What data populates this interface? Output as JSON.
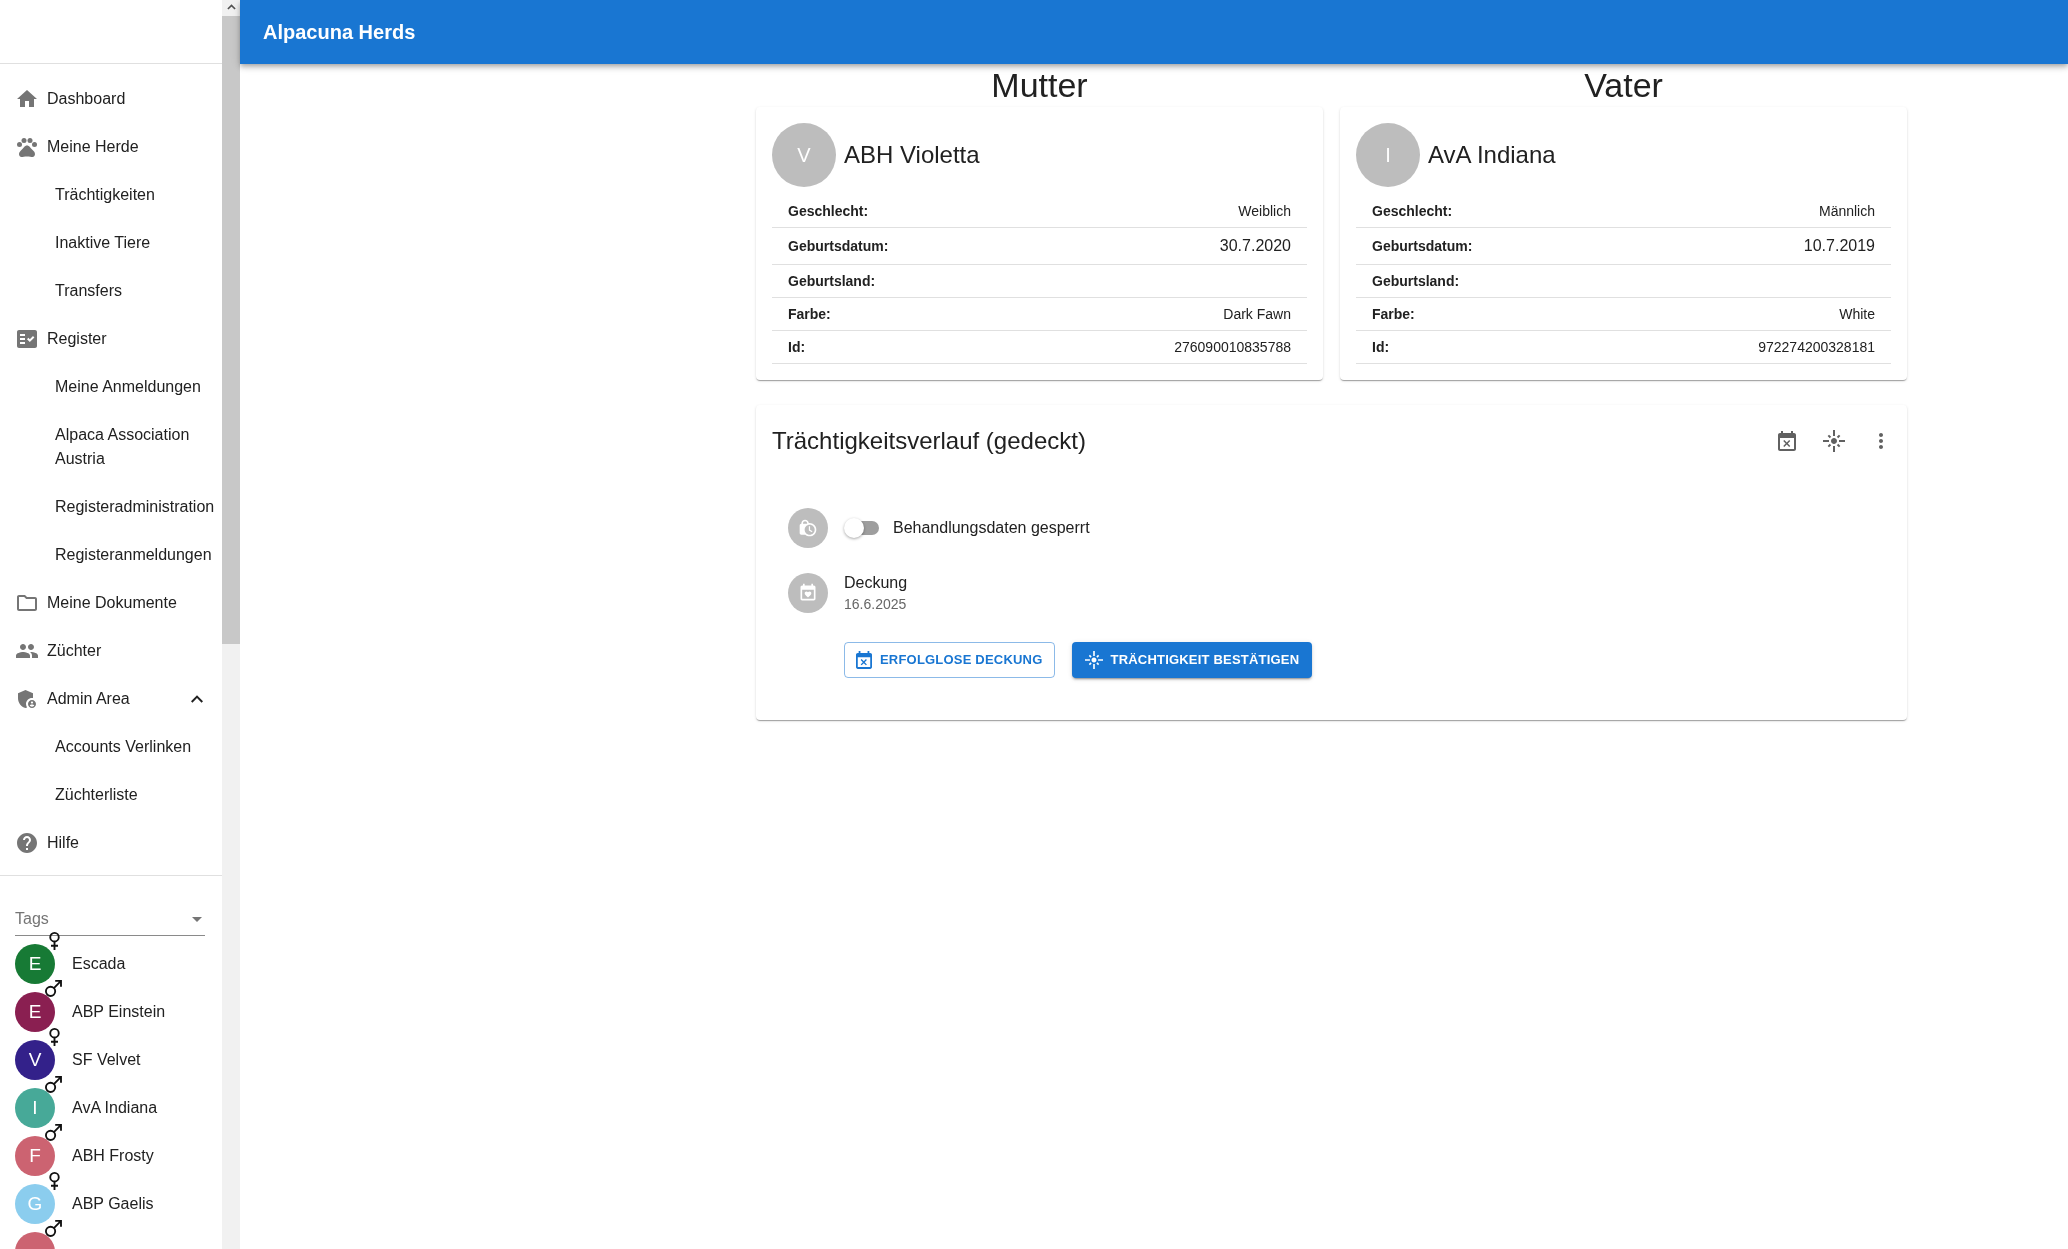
{
  "sidebar": {
    "nav": [
      {
        "label": "Dashboard"
      },
      {
        "label": "Meine Herde",
        "children": [
          {
            "label": "Trächtigkeiten"
          },
          {
            "label": "Inaktive Tiere"
          },
          {
            "label": "Transfers"
          }
        ]
      },
      {
        "label": "Register",
        "children": [
          {
            "label": "Meine Anmeldungen"
          },
          {
            "label": "Alpaca Association Austria"
          },
          {
            "label": "Registeradministration"
          },
          {
            "label": "Registeranmeldungen"
          }
        ]
      },
      {
        "label": "Meine Dokumente"
      },
      {
        "label": "Züchter"
      },
      {
        "label": "Admin Area",
        "expanded": true,
        "children": [
          {
            "label": "Accounts Verlinken"
          },
          {
            "label": "Züchterliste"
          }
        ]
      },
      {
        "label": "Hilfe"
      }
    ],
    "tags_select": {
      "label": "Tags"
    },
    "animals": [
      {
        "initial": "E",
        "name": "Escada",
        "color": "#177a35",
        "kind": "female"
      },
      {
        "initial": "E",
        "name": "ABP Einstein",
        "color": "#8a1f51",
        "kind": "male"
      },
      {
        "initial": "V",
        "name": "SF Velvet",
        "color": "#33218a",
        "kind": "female"
      },
      {
        "initial": "I",
        "name": "AvA Indiana",
        "color": "#47a998",
        "kind": "male"
      },
      {
        "initial": "F",
        "name": "ABH Frosty",
        "color": "#cc6371",
        "kind": "male"
      },
      {
        "initial": "G",
        "name": "ABP Gaelis",
        "color": "#8bcdee",
        "kind": "female"
      },
      {
        "color": "#cc6371",
        "kind": "male"
      }
    ]
  },
  "app_bar": {
    "title": "Alpacuna Herds"
  },
  "parents": [
    {
      "heading": "Mutter",
      "initial": "V",
      "name": "ABH Violetta",
      "fields": [
        {
          "label": "Geschlecht:",
          "value": "Weiblich",
          "kind": "text"
        },
        {
          "label": "Geburtsdatum:",
          "value": "30.7.2020",
          "kind": "date"
        },
        {
          "label": "Geburtsland:",
          "kind": "text"
        },
        {
          "label": "Farbe:",
          "value": "Dark Fawn",
          "kind": "text"
        },
        {
          "label": "Id:",
          "value": "276090010835788",
          "kind": "text"
        }
      ]
    },
    {
      "heading": "Vater",
      "initial": "I",
      "name": "AvA Indiana",
      "fields": [
        {
          "label": "Geschlecht:",
          "value": "Männlich",
          "kind": "text"
        },
        {
          "label": "Geburtsdatum:",
          "value": "10.7.2019",
          "kind": "date"
        },
        {
          "label": "Geburtsland:",
          "kind": "text"
        },
        {
          "label": "Farbe:",
          "value": "White",
          "kind": "text"
        },
        {
          "label": "Id:",
          "value": "972274200328181",
          "kind": "text"
        }
      ]
    }
  ],
  "pregnancy_card": {
    "title": "Trächtigkeitsverlauf (gedeckt)",
    "lock_toggle": {
      "label": "Behandlungsdaten gesperrt",
      "on": false
    },
    "events": [
      {
        "title": "Deckung",
        "date": "16.6.2025"
      }
    ],
    "buttons": [
      {
        "label": "ERFOLGLOSE DECKUNG",
        "kind": "outlined"
      },
      {
        "label": "TRÄCHTIGKEIT BESTÄTIGEN",
        "kind": "contained"
      }
    ]
  }
}
